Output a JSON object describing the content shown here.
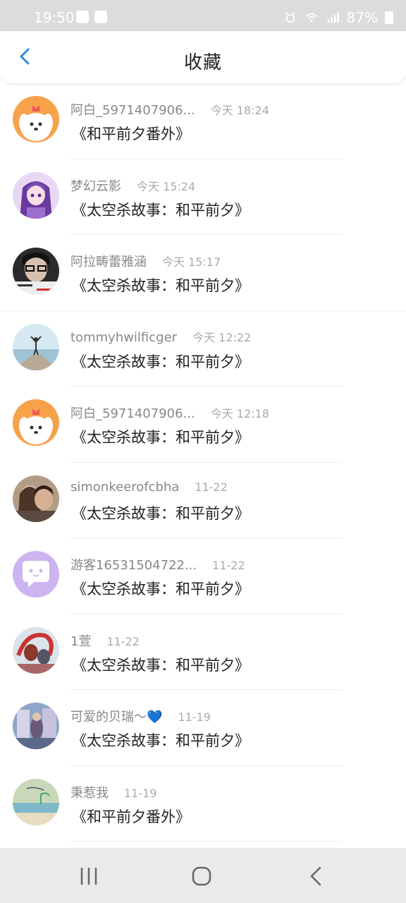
{
  "status_bar": {
    "time": "19:50",
    "battery": "87%"
  },
  "header": {
    "title": "收藏",
    "back_icon": "chevron-left-icon",
    "accent": "#2b8ce8"
  },
  "items": [
    {
      "user": "阿白_5971407906...",
      "time": "今天 18:24",
      "title": "《和平前夕番外》",
      "avatar": "orange-dog"
    },
    {
      "user": "梦幻云影",
      "time": "今天 15:24",
      "title": "《太空杀故事：和平前夕》",
      "avatar": "purple-anime"
    },
    {
      "user": "阿拉畴蕾雅涵",
      "time": "今天 15:17",
      "title": "《太空杀故事：和平前夕》",
      "avatar": "photo-girl"
    },
    {
      "user": "tommyhwilficger",
      "time": "今天 12:22",
      "title": "《太空杀故事：和平前夕》",
      "avatar": "sea-yoga"
    },
    {
      "user": "阿白_5971407906...",
      "time": "今天 12:18",
      "title": "《太空杀故事：和平前夕》",
      "avatar": "orange-dog"
    },
    {
      "user": "simonkeerofcbha",
      "time": "11-22",
      "title": "《太空杀故事：和平前夕》",
      "avatar": "couple-photo"
    },
    {
      "user": "游客16531504722...",
      "time": "11-22",
      "title": "《太空杀故事：和平前夕》",
      "avatar": "chat-bubble"
    },
    {
      "user": "1萱",
      "time": "11-22",
      "title": "《太空杀故事：和平前夕》",
      "avatar": "red-art"
    },
    {
      "user": "可爱的贝瑞～💙",
      "time": "11-19",
      "title": "《太空杀故事：和平前夕》",
      "avatar": "street-photo"
    },
    {
      "user": "秉惹我",
      "time": "11-19",
      "title": "《和平前夕番外》",
      "avatar": "beach-photo"
    }
  ],
  "nav": {
    "recent_icon": "recent-apps-icon",
    "home_icon": "home-icon",
    "back_icon": "back-icon"
  }
}
